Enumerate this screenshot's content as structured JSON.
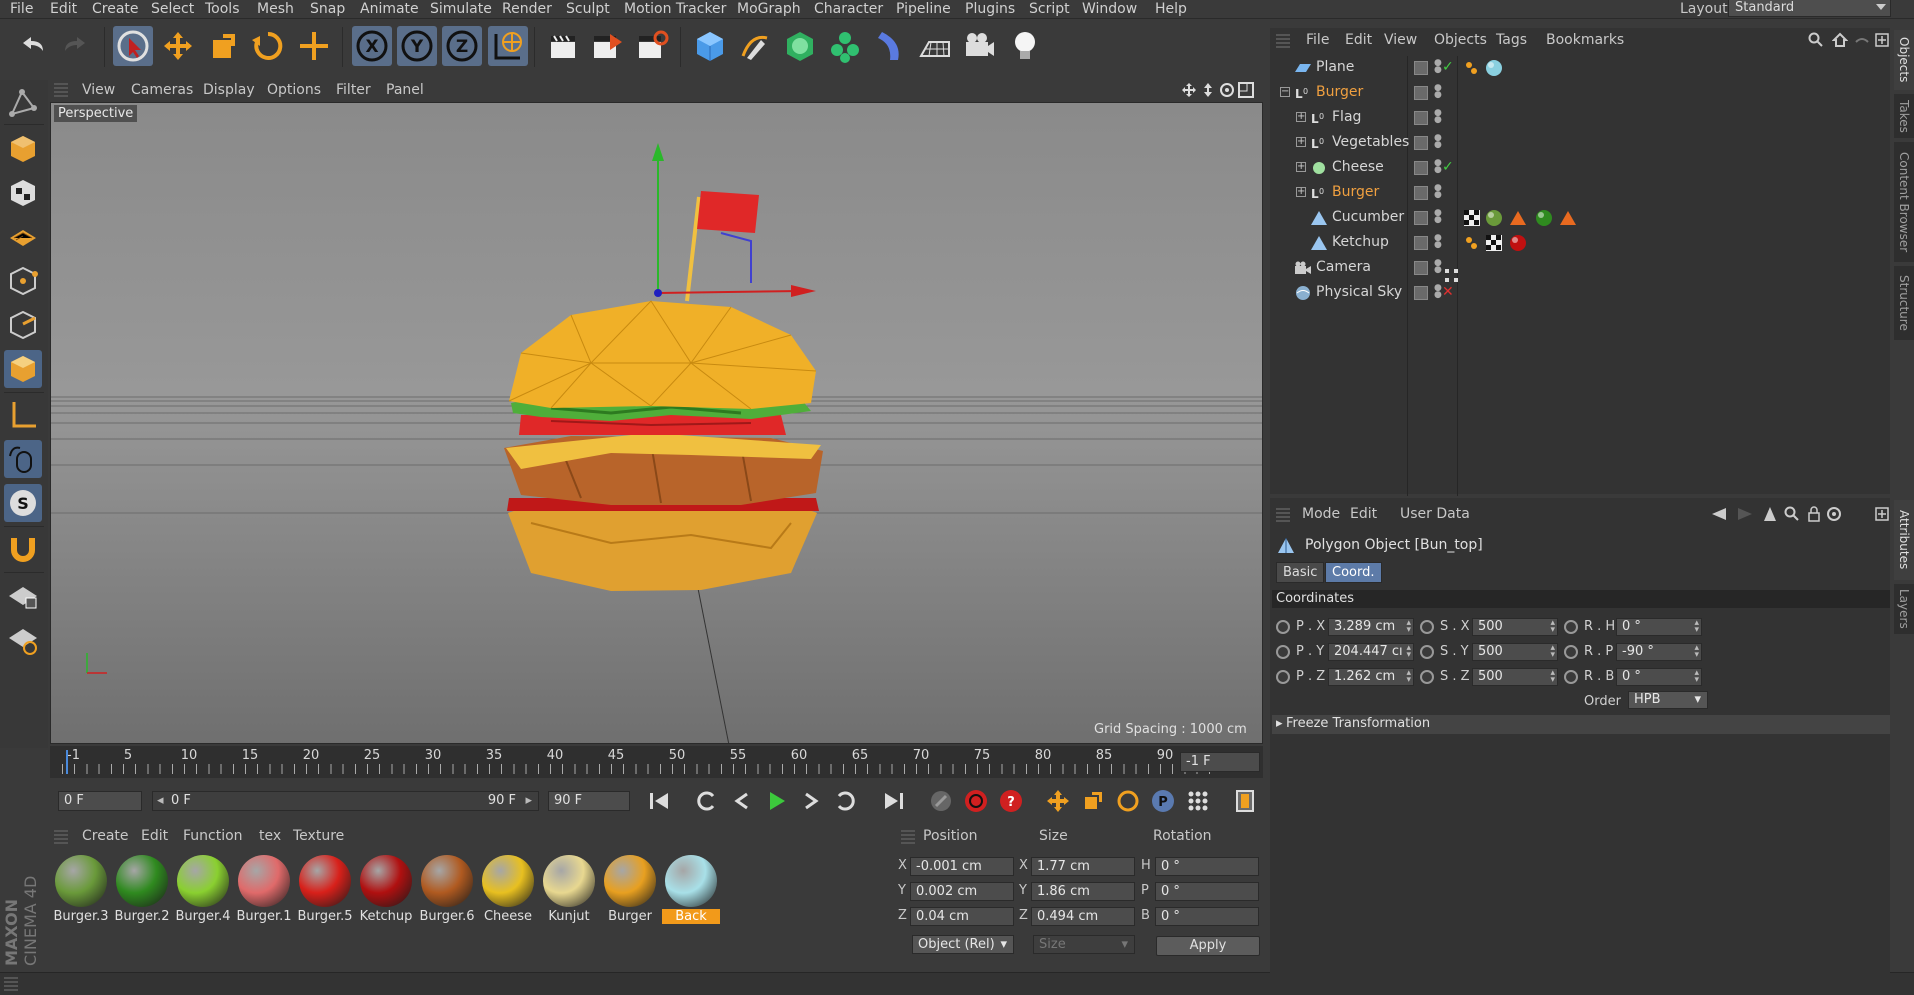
{
  "menubar": {
    "items": [
      "File",
      "Edit",
      "Create",
      "Select",
      "Tools",
      "Mesh",
      "Snap",
      "Animate",
      "Simulate",
      "Render",
      "Sculpt",
      "Motion Tracker",
      "MoGraph",
      "Character",
      "Pipeline",
      "Plugins",
      "Script",
      "Window",
      "Help"
    ],
    "layout_label": "Layout:",
    "layout_value": "Standard"
  },
  "viewport": {
    "menu": [
      "View",
      "Cameras",
      "Display",
      "Options",
      "Filter",
      "Panel"
    ],
    "label": "Perspective",
    "grid_spacing": "Grid Spacing : 1000 cm"
  },
  "timeline": {
    "ticks": [
      "5",
      "10",
      "15",
      "20",
      "25",
      "30",
      "35",
      "40",
      "45",
      "50",
      "55",
      "60",
      "65",
      "70",
      "75",
      "80",
      "85",
      "90"
    ],
    "start_tick": "-1",
    "current_frame_display": "-1 F",
    "current_frame": "0 F",
    "range_start": "0 F",
    "range_end": "90 F",
    "end_frame": "90 F"
  },
  "materials": {
    "menu": [
      "Create",
      "Edit",
      "Function",
      "tex",
      "Texture"
    ],
    "items": [
      {
        "label": "Burger.3",
        "color": "#6a9a3a"
      },
      {
        "label": "Burger.2",
        "color": "#2f8a1f"
      },
      {
        "label": "Burger.4",
        "color": "#8ad030"
      },
      {
        "label": "Burger.1",
        "color": "#e06a6a"
      },
      {
        "label": "Burger.5",
        "color": "#d8201a"
      },
      {
        "label": "Ketchup",
        "color": "#b01010"
      },
      {
        "label": "Burger.6",
        "color": "#b05a20"
      },
      {
        "label": "Cheese",
        "color": "#e8c020"
      },
      {
        "label": "Kunjut",
        "color": "#e8d890"
      },
      {
        "label": "Burger",
        "color": "#e8a020"
      },
      {
        "label": "Back",
        "color": "#a8e0e8"
      }
    ]
  },
  "coords": {
    "headers": [
      "Position",
      "Size",
      "Rotation"
    ],
    "rows": [
      {
        "axis": "X",
        "pos": "-0.001 cm",
        "size_axis": "X",
        "size": "1.77 cm",
        "rot_axis": "H",
        "rot": "0 °"
      },
      {
        "axis": "Y",
        "pos": "0.002 cm",
        "size_axis": "Y",
        "size": "1.86 cm",
        "rot_axis": "P",
        "rot": "0 °"
      },
      {
        "axis": "Z",
        "pos": "0.04 cm",
        "size_axis": "Z",
        "size": "0.494 cm",
        "rot_axis": "B",
        "rot": "0 °"
      }
    ],
    "mode_select": "Object (Rel)",
    "size_select": "Size",
    "apply_label": "Apply"
  },
  "object_manager": {
    "menu": [
      "File",
      "Edit",
      "View",
      "Objects",
      "Tags",
      "Bookmarks"
    ],
    "objects": [
      {
        "name": "Plane",
        "indent": 0,
        "highlight": false
      },
      {
        "name": "Burger",
        "indent": 0,
        "highlight": true
      },
      {
        "name": "Flag",
        "indent": 1,
        "highlight": false
      },
      {
        "name": "Vegetables",
        "indent": 1,
        "highlight": false
      },
      {
        "name": "Cheese",
        "indent": 1,
        "highlight": false
      },
      {
        "name": "Burger",
        "indent": 1,
        "highlight": true
      },
      {
        "name": "Cucumber",
        "indent": 1,
        "highlight": false
      },
      {
        "name": "Ketchup",
        "indent": 1,
        "highlight": false
      },
      {
        "name": "Camera",
        "indent": 0,
        "highlight": false
      },
      {
        "name": "Physical Sky",
        "indent": 0,
        "highlight": false
      }
    ]
  },
  "attributes": {
    "menu": [
      "Mode",
      "Edit",
      "User Data"
    ],
    "object_title": "Polygon Object [Bun_top]",
    "tabs": [
      "Basic",
      "Coord."
    ],
    "section": "Coordinates",
    "rows": [
      {
        "p_label": "P . X",
        "p": "3.289 cm",
        "s_label": "S . X",
        "s": "500",
        "r_label": "R . H",
        "r": "0 °"
      },
      {
        "p_label": "P . Y",
        "p": "204.447 cı",
        "s_label": "S . Y",
        "s": "500",
        "r_label": "R . P",
        "r": "-90 °"
      },
      {
        "p_label": "P . Z",
        "p": "1.262 cm",
        "s_label": "S . Z",
        "s": "500",
        "r_label": "R . B",
        "r": "0 °"
      }
    ],
    "order_label": "Order",
    "order_value": "HPB",
    "freeze": "Freeze Transformation"
  },
  "right_tabs": [
    "Objects",
    "Takes",
    "Content Browser",
    "Structure",
    "Attributes",
    "Layers"
  ],
  "brand": {
    "maxon": "MAXON",
    "product": "CINEMA 4D"
  }
}
